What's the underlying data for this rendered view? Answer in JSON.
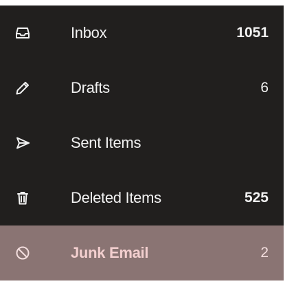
{
  "folders": [
    {
      "label": "Inbox",
      "count": "1051",
      "icon": "inbox-icon",
      "count_bold": true,
      "selected": false
    },
    {
      "label": "Drafts",
      "count": "6",
      "icon": "pencil-icon",
      "count_bold": false,
      "selected": false
    },
    {
      "label": "Sent Items",
      "count": "",
      "icon": "send-icon",
      "count_bold": false,
      "selected": false
    },
    {
      "label": "Deleted Items",
      "count": "525",
      "icon": "trash-icon",
      "count_bold": true,
      "selected": false
    },
    {
      "label": "Junk Email",
      "count": "2",
      "icon": "block-icon",
      "count_bold": false,
      "selected": true
    }
  ],
  "colors": {
    "pane_background": "#211f1e",
    "selected_background": "#8a7473",
    "text": "#f2f2f2",
    "selected_text": "#f3cfcf"
  }
}
